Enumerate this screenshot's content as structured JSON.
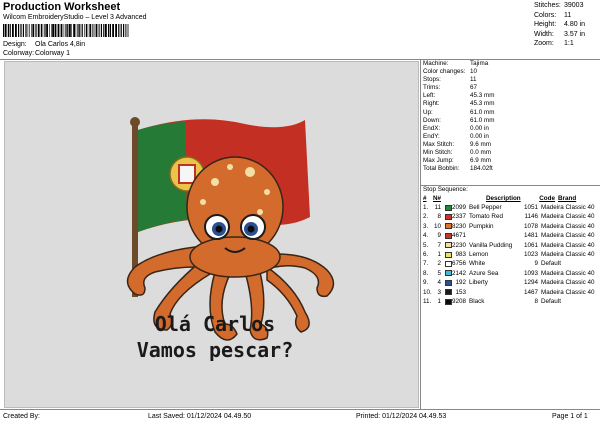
{
  "header": {
    "title": "Production Worksheet",
    "subtitle": "Wilcom EmbroideryStudio – Level 3 Advanced",
    "design_label": "Design:",
    "design_value": "Ola Carlos 4,8in",
    "colorway_label": "Colorway:",
    "colorway_value": "Colorway 1"
  },
  "stats": [
    {
      "label": "Stitches:",
      "value": "39003"
    },
    {
      "label": "Colors:",
      "value": "11"
    },
    {
      "label": "Height:",
      "value": "4.80 in"
    },
    {
      "label": "Width:",
      "value": "3.57 in"
    },
    {
      "label": "Zoom:",
      "value": "1:1"
    }
  ],
  "properties": [
    {
      "label": "Machine:",
      "value": "Tajima"
    },
    {
      "label": "Color changes:",
      "value": "10"
    },
    {
      "label": "Stops:",
      "value": "11"
    },
    {
      "label": "Trims:",
      "value": "67"
    },
    {
      "label": "Left:",
      "value": "45.3 mm"
    },
    {
      "label": "Right:",
      "value": "45.3 mm"
    },
    {
      "label": "Up:",
      "value": "61.0 mm"
    },
    {
      "label": "Down:",
      "value": "61.0 mm"
    },
    {
      "label": "EndX:",
      "value": "0.00 in"
    },
    {
      "label": "EndY:",
      "value": "0.00 in"
    },
    {
      "label": "Max Stitch:",
      "value": "9.6 mm"
    },
    {
      "label": "Min Stitch:",
      "value": "0.0 mm"
    },
    {
      "label": "Max Jump:",
      "value": "6.9 mm"
    },
    {
      "label": "Total Bobbin:",
      "value": "184.02ft"
    }
  ],
  "sequence": {
    "title": "Stop Sequence:",
    "headers": {
      "n": "#",
      "n2": "N#",
      "desc": "Description",
      "code": "Code",
      "brand": "Brand"
    },
    "rows": [
      {
        "n": "1.",
        "s": "11",
        "color": "#1f8a3a",
        "code": "2099",
        "desc": "Bell Pepper",
        "code2": "1051",
        "brand": "Madeira Classic 40"
      },
      {
        "n": "2.",
        "s": "8",
        "color": "#d2312a",
        "code": "2337",
        "desc": "Tomato Red",
        "code2": "1146",
        "brand": "Madeira Classic 40"
      },
      {
        "n": "3.",
        "s": "10",
        "color": "#e2761f",
        "code": "8230",
        "desc": "Pumpkin",
        "code2": "1078",
        "brand": "Madeira Classic 40"
      },
      {
        "n": "4.",
        "s": "9",
        "color": "#c23a26",
        "code": "4671",
        "desc": "",
        "code2": "1481",
        "brand": "Madeira Classic 40"
      },
      {
        "n": "5.",
        "s": "7",
        "color": "#f3dfa3",
        "code": "2230",
        "desc": "Vanilla Pudding",
        "code2": "1061",
        "brand": "Madeira Classic 40"
      },
      {
        "n": "6.",
        "s": "1",
        "color": "#f5e05b",
        "code": "983",
        "desc": "Lemon",
        "code2": "1023",
        "brand": "Madeira Classic 40"
      },
      {
        "n": "7.",
        "s": "2",
        "color": "#ffffff",
        "code": "6756",
        "desc": "White",
        "code2": "9",
        "brand": "Default"
      },
      {
        "n": "8.",
        "s": "5",
        "color": "#47b9d6",
        "code": "2142",
        "desc": "Azure Sea",
        "code2": "1093",
        "brand": "Madeira Classic 40"
      },
      {
        "n": "9.",
        "s": "4",
        "color": "#2c4f8e",
        "code": "192",
        "desc": "Liberty",
        "code2": "1294",
        "brand": "Madeira Classic 40"
      },
      {
        "n": "10.",
        "s": "3",
        "color": "#1b1b1b",
        "code": "153",
        "desc": "",
        "code2": "1467",
        "brand": "Madeira Classic 40"
      },
      {
        "n": "11.",
        "s": "1",
        "color": "#0a0a0a",
        "code": "9208",
        "desc": "Black",
        "code2": "8",
        "brand": "Default"
      }
    ]
  },
  "design_text": {
    "line1": "Olá Carlos",
    "line2": "Vamos pescar?"
  },
  "footer": {
    "created_by": "Created By:",
    "last_saved": "Last Saved: 01/12/2024 04.49.50",
    "printed": "Printed: 01/12/2024 04.49.53",
    "page": "Page 1 of 1"
  }
}
